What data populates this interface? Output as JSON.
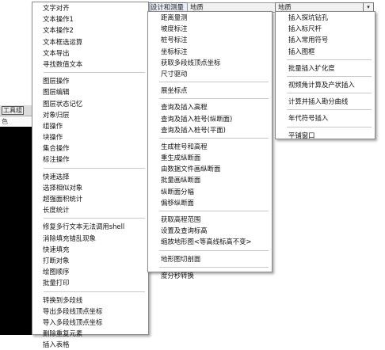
{
  "background": {
    "toolbar_label": "工具组",
    "strip_label": "色"
  },
  "tabs": {
    "survey": "设计和测量",
    "terrain_left": "地质",
    "terrain_right": "地质"
  },
  "menu1": [
    {
      "label": "文字对齐"
    },
    {
      "label": "文本操作1"
    },
    {
      "label": "文本操作2"
    },
    {
      "label": "文本框选运算"
    },
    {
      "label": "文本导出"
    },
    {
      "label": "寻找数值文本"
    },
    {
      "sep": true
    },
    {
      "label": "图层操作"
    },
    {
      "label": "图层编辑"
    },
    {
      "label": "图层状态记忆"
    },
    {
      "label": "对象归层"
    },
    {
      "label": "组操作"
    },
    {
      "label": "块操作"
    },
    {
      "label": "集合操作"
    },
    {
      "label": "标注操作"
    },
    {
      "sep": true
    },
    {
      "label": "快速选择"
    },
    {
      "label": "选择相似对象"
    },
    {
      "label": "超强面积统计"
    },
    {
      "label": "长度统计"
    },
    {
      "sep": true
    },
    {
      "label": "修复多行文本无法调用shell"
    },
    {
      "label": "消除填充错乱现象"
    },
    {
      "label": "快速填充"
    },
    {
      "label": "打断对象"
    },
    {
      "label": "绘图顺序"
    },
    {
      "label": "批量打印"
    },
    {
      "sep": true
    },
    {
      "label": "转换到多段线"
    },
    {
      "label": "导出多段线顶点坐标"
    },
    {
      "label": "导入多段线顶点坐标"
    },
    {
      "label": "删除重复元素"
    },
    {
      "label": "插入表格"
    }
  ],
  "menu2": [
    {
      "label": "距离量测"
    },
    {
      "label": "坡度标注"
    },
    {
      "label": "桩号标注"
    },
    {
      "label": "坐标标注"
    },
    {
      "label": "获取多段线顶点坐标"
    },
    {
      "label": "尺寸驱动"
    },
    {
      "sep": true
    },
    {
      "label": "展坐标点"
    },
    {
      "sep": true
    },
    {
      "label": "查询及插入高程"
    },
    {
      "label": "查询及插入桩号(纵断面)"
    },
    {
      "label": "查询及插入桩号(平面)"
    },
    {
      "sep": true
    },
    {
      "label": "生成桩号和高程"
    },
    {
      "label": "重生成纵断面"
    },
    {
      "label": "由数据文件画纵断面"
    },
    {
      "label": "批量画纵断面"
    },
    {
      "label": "纵断面分幅"
    },
    {
      "label": "偏移纵断面"
    },
    {
      "sep": true
    },
    {
      "label": "获取高程范围"
    },
    {
      "label": "设置及查询标高"
    },
    {
      "label": "缩放地形图<等高线标高不变>"
    },
    {
      "sep": true
    },
    {
      "label": "地形图切剖面"
    },
    {
      "sep": true
    },
    {
      "label": "度分秒转换"
    }
  ],
  "menu3": [
    {
      "label": "插入探坑钻孔"
    },
    {
      "label": "插入标尺杆"
    },
    {
      "label": "插入常用符号"
    },
    {
      "label": "插入图框"
    },
    {
      "sep": true
    },
    {
      "label": "批量插入扩化度"
    },
    {
      "sep": true
    },
    {
      "label": "视频角计算及产状插入"
    },
    {
      "sep": true
    },
    {
      "label": "计算并插入勘分曲线"
    },
    {
      "sep": true
    },
    {
      "label": "年代符号插入"
    },
    {
      "sep": true
    },
    {
      "label": "平铺窗口"
    }
  ],
  "icons": {
    "dropdown": "chevron-down-icon"
  }
}
